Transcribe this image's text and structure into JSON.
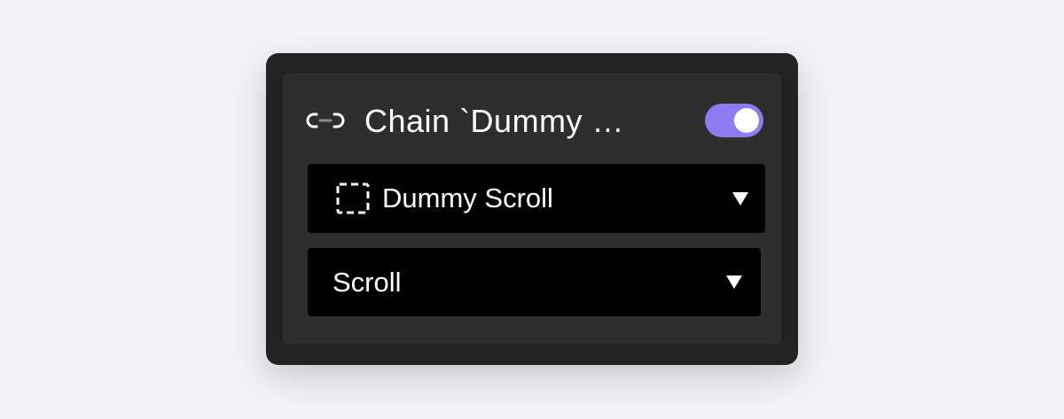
{
  "panel": {
    "title": "Chain `Dummy …",
    "enabled": true,
    "accent_color": "#8e7cf2",
    "icon": "chain-link-icon"
  },
  "target_select": {
    "icon": "dashed-frame-icon",
    "value": "Dummy Scroll"
  },
  "action_select": {
    "value": "Scroll"
  }
}
